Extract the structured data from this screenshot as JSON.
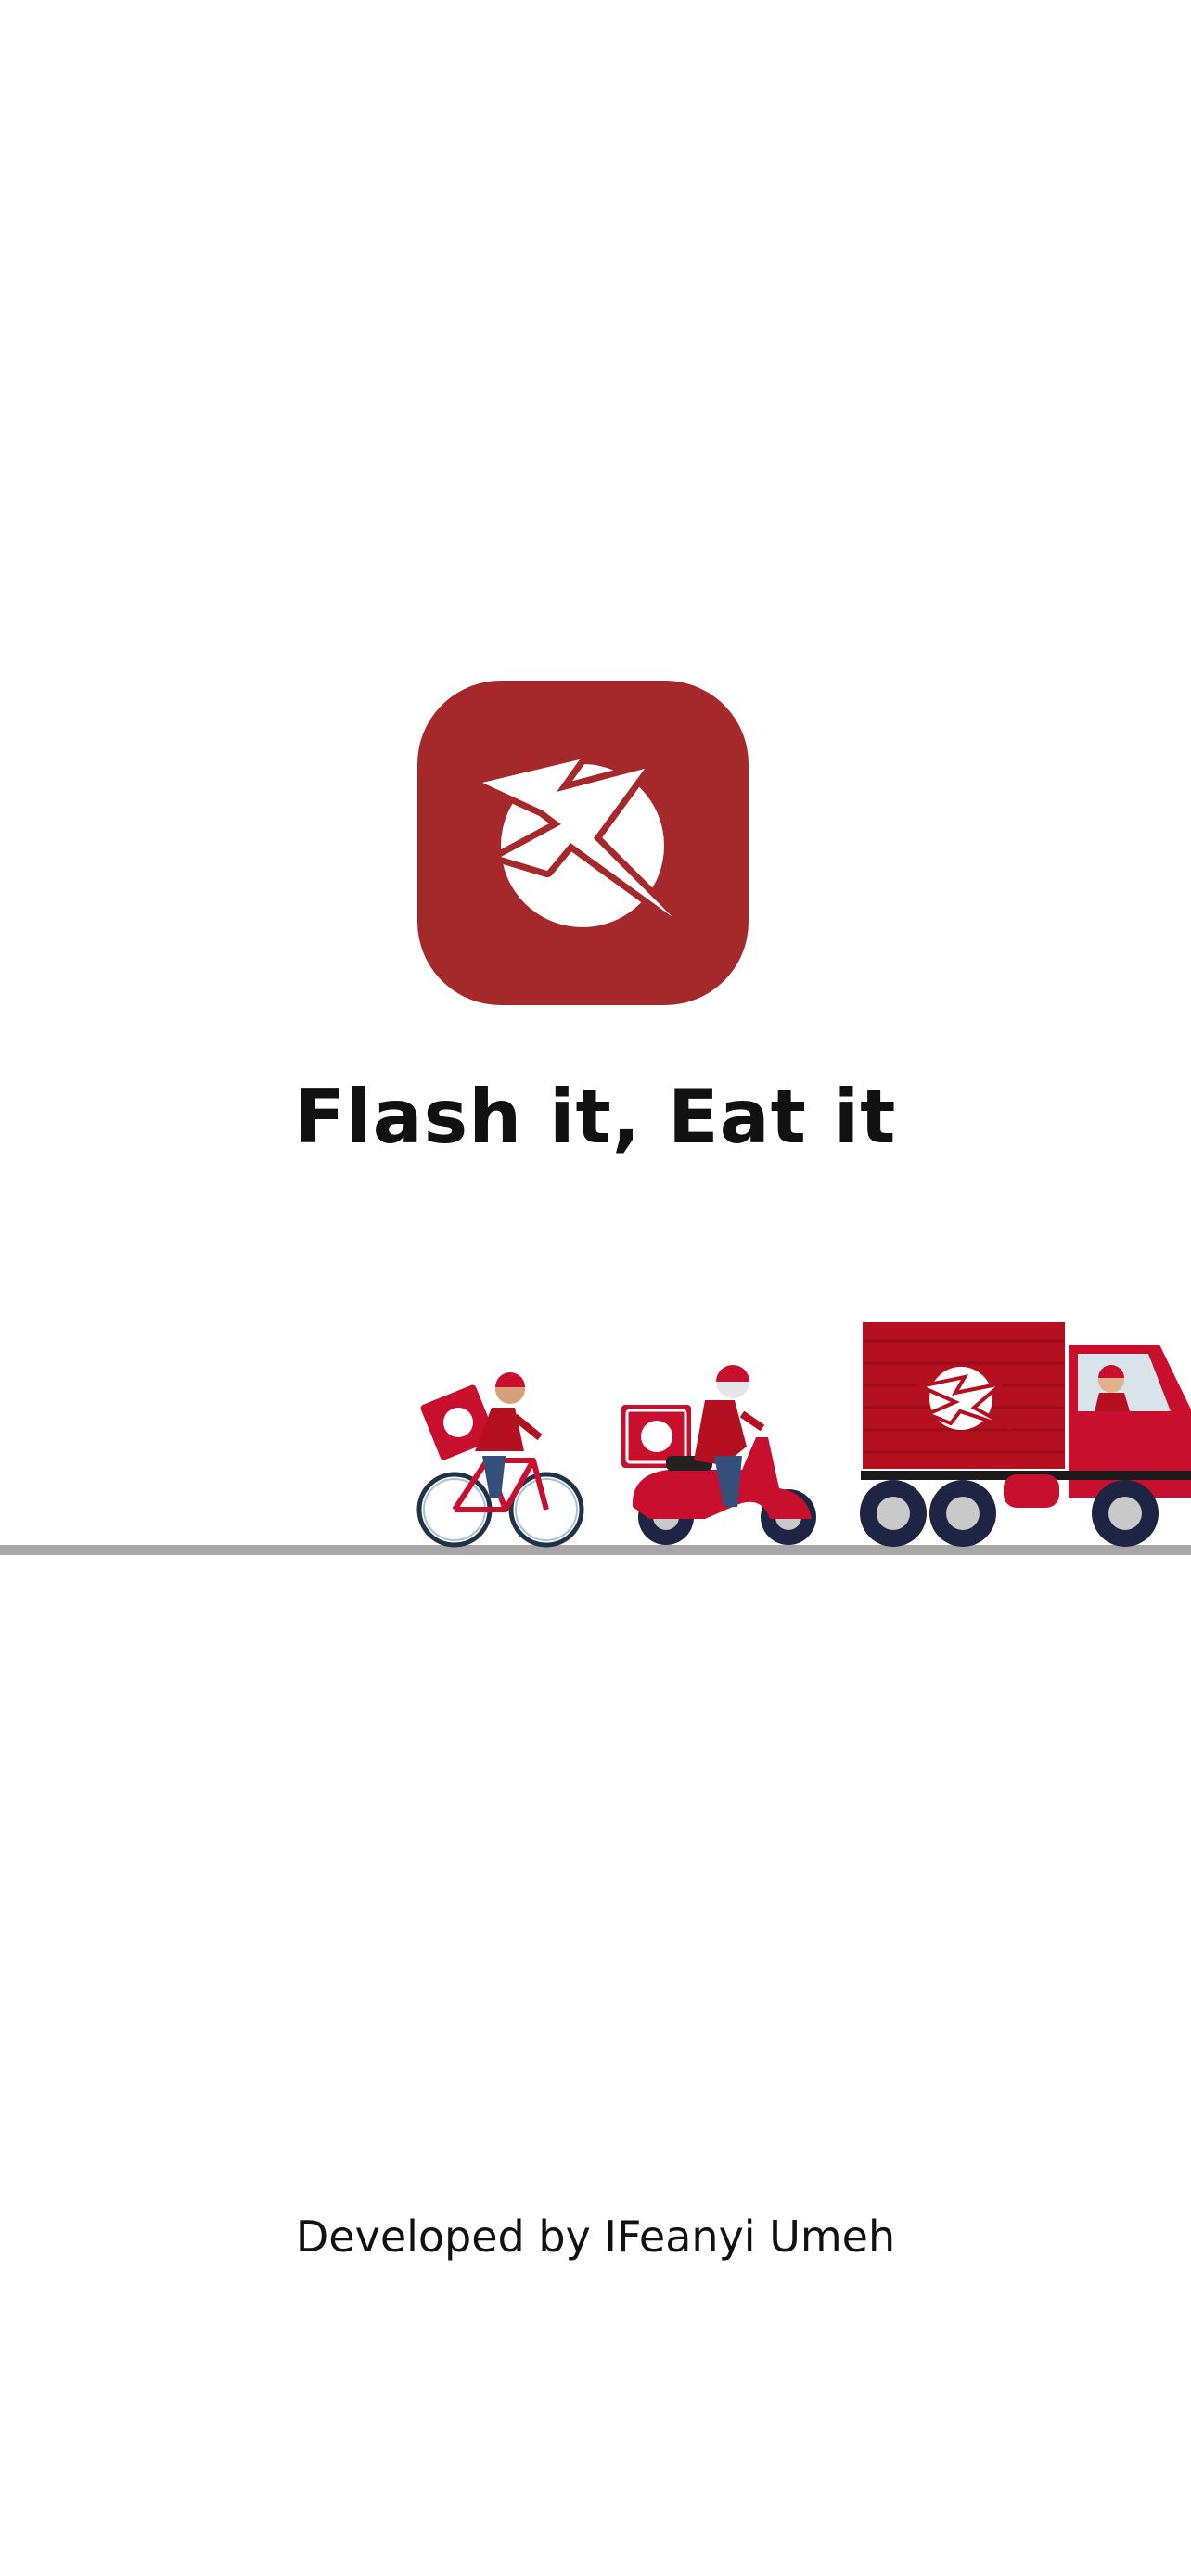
{
  "splash": {
    "tagline": "Flash it, Eat it",
    "credit": "Developed by IFeanyi Umeh",
    "logo_icon": "lightning-bolt-plate-icon",
    "scene_icons": [
      "bicycle-courier-icon",
      "scooter-courier-icon",
      "delivery-truck-icon"
    ]
  },
  "colors": {
    "brand_red": "#a5292a",
    "vehicle_red": "#c8102e",
    "road_gray": "#a9a6a7",
    "text": "#111111",
    "background": "#ffffff"
  }
}
